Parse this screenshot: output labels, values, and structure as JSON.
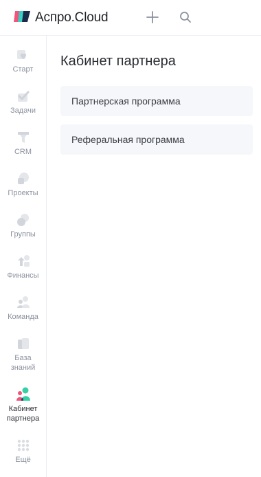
{
  "header": {
    "brand": "Аспро.Cloud",
    "add_icon": "plus-icon",
    "search_icon": "search-icon"
  },
  "colors": {
    "logo_pink": "#f0567a",
    "logo_teal": "#2fd3c4",
    "logo_dark": "#1c2a4a",
    "icon_gray": "#d8dbe1",
    "text_gray": "#8b919e",
    "card_bg": "#f6f7fa",
    "active_green": "#35d0a4",
    "active_pink": "#f0567a",
    "active_navy": "#2c3a6b"
  },
  "sidebar": {
    "items": [
      {
        "label": "Старт",
        "icon": "heart-icon"
      },
      {
        "label": "Задачи",
        "icon": "check-icon"
      },
      {
        "label": "CRM",
        "icon": "funnel-icon"
      },
      {
        "label": "Проекты",
        "icon": "projects-icon"
      },
      {
        "label": "Группы",
        "icon": "groups-icon"
      },
      {
        "label": "Финансы",
        "icon": "finance-icon"
      },
      {
        "label": "Команда",
        "icon": "team-icon"
      },
      {
        "label": "База\nзнаний",
        "icon": "knowledge-base-icon"
      },
      {
        "label": "Кабинет\nпартнера",
        "icon": "partner-icon",
        "active": true
      },
      {
        "label": "Ещё",
        "icon": "more-dots-icon"
      }
    ]
  },
  "main": {
    "title": "Кабинет партнера",
    "cards": [
      {
        "label": "Партнерская программа"
      },
      {
        "label": "Реферальная программа"
      }
    ]
  }
}
